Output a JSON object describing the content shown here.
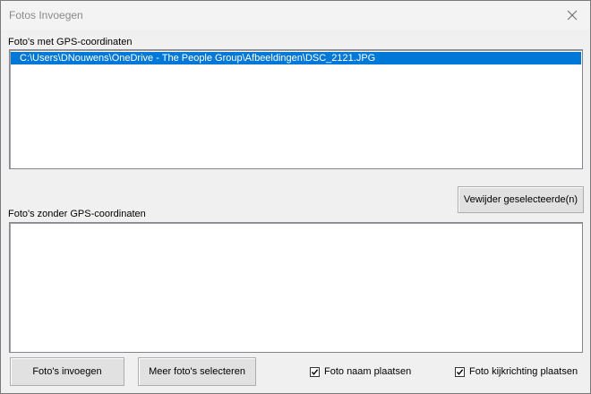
{
  "window": {
    "title": "Fotos Invoegen"
  },
  "gps_section": {
    "label": "Foto's met GPS-coordinaten",
    "items": [
      {
        "text": "C:\\Users\\DNouwens\\OneDrive - The People Group\\Afbeeldingen\\DSC_2121.JPG",
        "selected": true
      }
    ]
  },
  "remove_button": {
    "label": "Vewijder geselecteerde(n)"
  },
  "no_gps_section": {
    "label": "Foto's zonder GPS-coordinaten",
    "items": []
  },
  "footer": {
    "insert_label": "Foto's invoegen",
    "select_more_label": "Meer foto's selecteren",
    "checkbox_name": {
      "label": "Foto naam plaatsen",
      "checked": true
    },
    "checkbox_direction": {
      "label": "Foto kijkrichting plaatsen",
      "checked": true
    }
  },
  "colors": {
    "selection": "#0078d7",
    "background": "#f0f0f0"
  }
}
